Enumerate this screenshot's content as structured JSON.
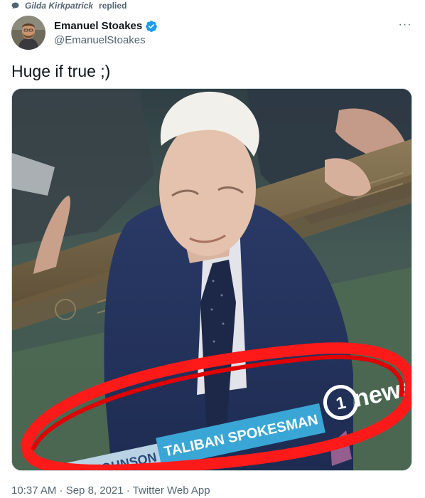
{
  "social_context": {
    "user": "Gilda Kirkpatrick",
    "action": "replied",
    "icon": "reply-bubble-icon"
  },
  "author": {
    "display_name": "Emanuel Stoakes",
    "handle": "@EmanuelStoakes",
    "verified": true,
    "verified_icon": "verified-badge-icon",
    "verified_color": "#1d9bf0"
  },
  "tweet": {
    "text": "Huge if true ;)"
  },
  "media": {
    "lower_third": {
      "name": "BORIS JOHNSON",
      "title": "TALIBAN SPOKESMAN",
      "channel_number": "1",
      "channel_name": "news"
    },
    "annotation_color": "#ff1a1a"
  },
  "meta": {
    "timestamp": "10:37 AM · Sep 8, 2021 · Twitter Web App"
  },
  "more_label": "···"
}
